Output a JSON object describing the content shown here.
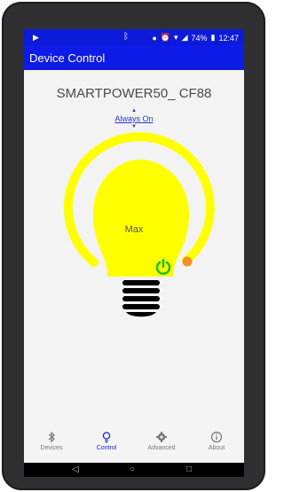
{
  "status_bar": {
    "battery": "74%",
    "time": "12:47"
  },
  "app_bar": {
    "title": "Device Control"
  },
  "device": {
    "name": "SMARTPOWER50_ CF88",
    "mode": "Always On",
    "level_label": "Max",
    "level": 1.0
  },
  "colors": {
    "app_bar": "#0e1be6",
    "bulb": "#ffff00",
    "ring_handle": "#f5911f",
    "power_icon": "#22c21f",
    "nav_active": "#1c24d8",
    "bulb_base": "#000000"
  },
  "bottom_nav": {
    "items": [
      {
        "label": "Devices",
        "icon": "bluetooth-icon",
        "active": false
      },
      {
        "label": "Control",
        "icon": "bulb-icon",
        "active": true
      },
      {
        "label": "Advanced",
        "icon": "gear-icon",
        "active": false
      },
      {
        "label": "About",
        "icon": "info-icon",
        "active": false
      }
    ]
  }
}
